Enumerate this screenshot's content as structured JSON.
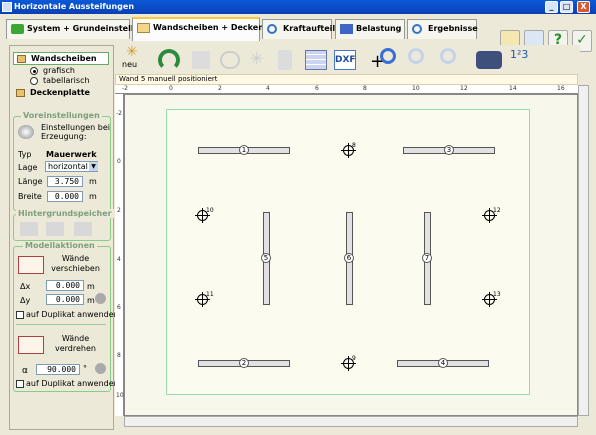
{
  "window": {
    "title": "Horizontale Aussteifungen",
    "min": "_",
    "max": "□",
    "close": "X"
  },
  "tabs": [
    {
      "label": "System + Grundeinstellungen"
    },
    {
      "label": "Wandscheiben + Deckenplatte"
    },
    {
      "label": "Kraftaufteilung"
    },
    {
      "label": "Belastung"
    },
    {
      "label": "Ergebnisse"
    }
  ],
  "toolbar": {
    "new_label": "neu",
    "dxf_label": "DXF",
    "plus_label": "+"
  },
  "status": "Wand 5 manuell positioniert",
  "nav": {
    "walls": "Wandscheiben",
    "graphic": "grafisch",
    "table": "tabellarisch",
    "slab": "Deckenplatte"
  },
  "preset": {
    "title": "Voreinstellungen",
    "info": "Einstellungen bei Erzeugung:",
    "type_label": "Typ",
    "type_value": "Mauerwerk",
    "position_label": "Lage",
    "position_value": "horizontal",
    "length_label": "Länge",
    "length_value": "3.750",
    "length_unit": "m",
    "width_label": "Breite",
    "width_value": "0.000",
    "width_unit": "m"
  },
  "memory": {
    "title": "Hintergrundspeicher"
  },
  "actions": {
    "title": "Modellaktionen",
    "move_label": "Wände verschieben",
    "dx_label": "Δx",
    "dx_value": "0.000",
    "dx_unit": "m",
    "dy_label": "Δy",
    "dy_value": "0.000",
    "dy_unit": "m",
    "dup1": "auf Duplikat anwenden",
    "rotate_label": "Wände verdrehen",
    "alpha_label": "α",
    "alpha_value": "90.000",
    "alpha_unit": "°",
    "dup2": "auf Duplikat anwenden"
  },
  "ruler": {
    "top": [
      "-2",
      "0",
      "2",
      "4",
      "6",
      "8",
      "10",
      "12",
      "14",
      "16"
    ],
    "left": [
      "-2",
      "0",
      "2",
      "4",
      "6",
      "8",
      "10"
    ]
  },
  "walls": [
    {
      "num": "1",
      "orient": "h"
    },
    {
      "num": "2",
      "orient": "h"
    },
    {
      "num": "3",
      "orient": "h"
    },
    {
      "num": "4",
      "orient": "h"
    },
    {
      "num": "5",
      "orient": "v"
    },
    {
      "num": "6",
      "orient": "v"
    },
    {
      "num": "7",
      "orient": "v"
    }
  ],
  "points": [
    "8",
    "9",
    "10",
    "11",
    "12",
    "13"
  ]
}
